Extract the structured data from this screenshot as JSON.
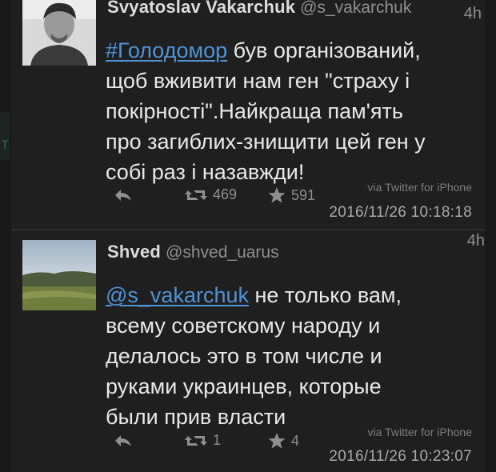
{
  "colors": {
    "background": "#1f1f1f",
    "text": "#e8e8e8",
    "muted": "#8f8f8f",
    "link": "#4f93d6"
  },
  "tweets": [
    {
      "display_name": "Svyatoslav Vakarchuk",
      "handle": "@s_vakarchuk",
      "age": "4h",
      "body": {
        "hashtag": "#Голодомор",
        "line1_rest": " був організований,",
        "line2": "щоб вживити нам ген \"страху і",
        "line3": "покірності\".Найкраща пам'ять",
        "line4": "про загиблих-знищити цей ген у",
        "line5": "собі раз і назавжди!"
      },
      "retweets": "469",
      "favorites": "591",
      "via": "via Twitter for iPhone",
      "timestamp": "2016/11/26 10:18:18"
    },
    {
      "display_name": "Shved",
      "handle": "@shved_uarus",
      "age": "4h",
      "body": {
        "mention": "@s_vakarchuk",
        "line1_rest": " не только вам,",
        "line2": "всему советскому народу и",
        "line3": "делалось это в том числе и",
        "line4": "руками украинцев, которые",
        "line5": "были прив власти"
      },
      "retweets": "1",
      "favorites": "4",
      "via": "via Twitter for iPhone",
      "timestamp": "2016/11/26 10:23:07"
    }
  ],
  "icons": {
    "reply": "reply-icon",
    "retweet": "retweet-icon",
    "favorite": "star-icon"
  }
}
